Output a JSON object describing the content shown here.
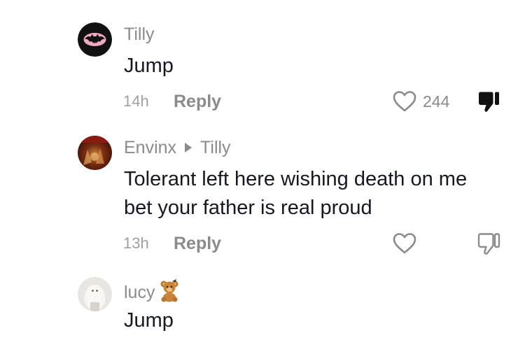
{
  "comments": [
    {
      "author": "Tilly",
      "reply_to": "",
      "emoji": "",
      "text": "Jump",
      "text_line2": "",
      "time": "14h",
      "reply_label": "Reply",
      "likes": "244",
      "disliked": true,
      "avatar_icon": "batman-logo-icon"
    },
    {
      "author": "Envinx",
      "reply_to": "Tilly",
      "emoji": "",
      "text": "Tolerant left here wishing death on me",
      "text_line2": "bet your father is real proud",
      "time": "13h",
      "reply_label": "Reply",
      "likes": "",
      "disliked": false,
      "avatar_icon": "dark-red-photo-avatar"
    },
    {
      "author": "lucy",
      "reply_to": "",
      "emoji": "🧸",
      "text": "Jump",
      "text_line2": "",
      "time": "",
      "reply_label": "",
      "likes": "",
      "disliked": false,
      "avatar_icon": "doll-photo-avatar"
    }
  ],
  "colors": {
    "text_primary": "#161823",
    "text_secondary": "#8a8a8f",
    "background": "#ffffff"
  }
}
